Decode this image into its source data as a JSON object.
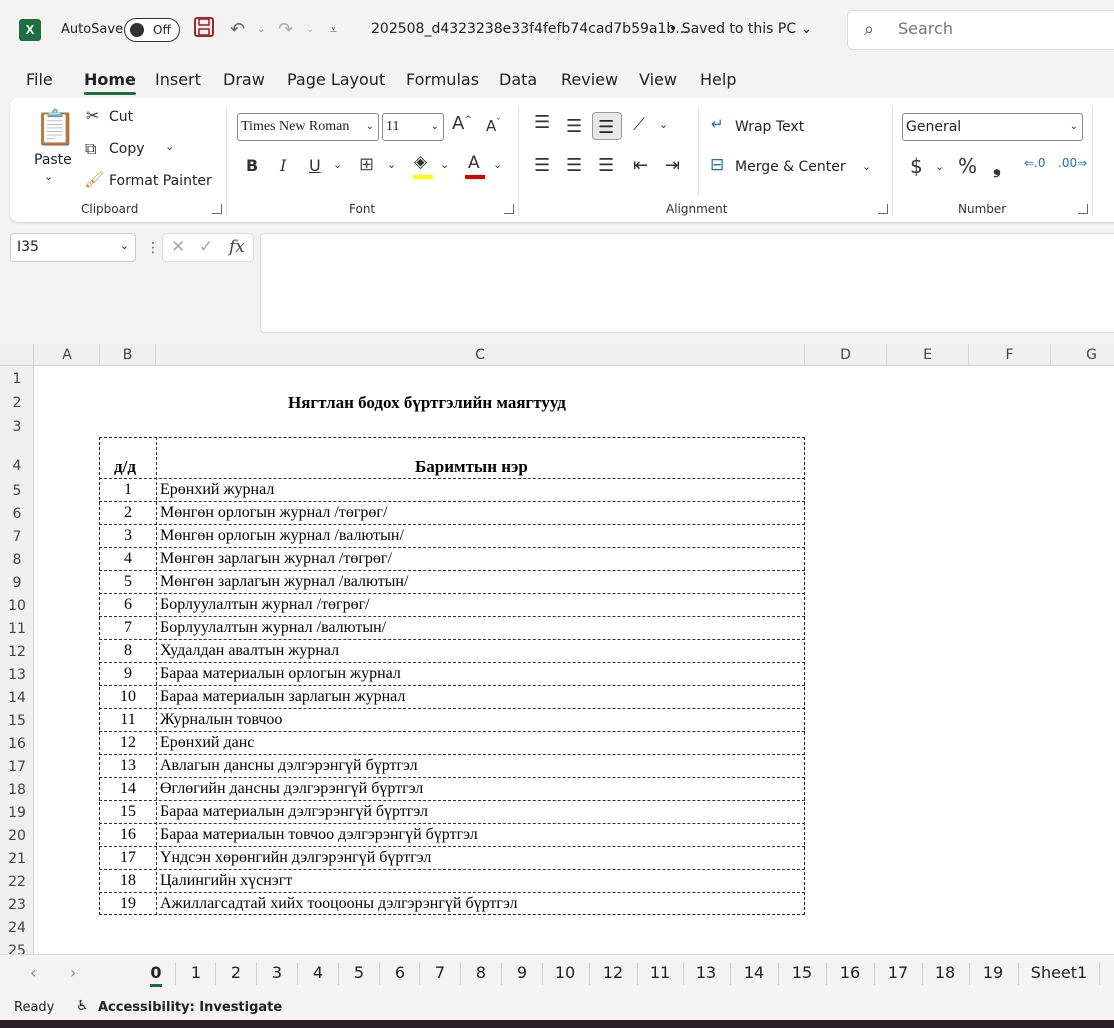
{
  "titlebar": {
    "app_icon": "excel-logo",
    "logo_letter": "X",
    "autosave_label": "AutoSave",
    "autosave_state": "Off",
    "filename": "202508_d4323238e33f4fefb74cad7b59a1b...",
    "saved_status": "• Saved to this PC",
    "search_placeholder": "Search"
  },
  "tabs": [
    "File",
    "Home",
    "Insert",
    "Draw",
    "Page Layout",
    "Formulas",
    "Data",
    "Review",
    "View",
    "Help"
  ],
  "active_tab": "Home",
  "ribbon": {
    "clipboard": {
      "label": "Clipboard",
      "paste": "Paste",
      "cut": "Cut",
      "copy": "Copy",
      "format_painter": "Format Painter"
    },
    "font": {
      "label": "Font",
      "font_name": "Times New Roman",
      "font_size": "11",
      "bold": "B",
      "italic": "I",
      "underline": "U"
    },
    "alignment": {
      "label": "Alignment",
      "wrap_text": "Wrap Text",
      "merge_center": "Merge & Center"
    },
    "number": {
      "label": "Number",
      "format": "General",
      "currency": "$",
      "percent": "%",
      "comma": "❟"
    }
  },
  "formula_bar": {
    "name_box": "I35",
    "formula": ""
  },
  "grid": {
    "columns": [
      "A",
      "B",
      "C",
      "D",
      "E",
      "F",
      "G"
    ],
    "rows": [
      "1",
      "2",
      "3",
      "4",
      "5",
      "6",
      "7",
      "8",
      "9",
      "10",
      "11",
      "12",
      "13",
      "14",
      "15",
      "16",
      "17",
      "18",
      "19",
      "20",
      "21",
      "22",
      "23",
      "24",
      "25"
    ],
    "sheet_title": "Нягтлан бодох бүртгэлийн маягтууд",
    "header_num": "д/д",
    "header_name": "Баримтын нэр",
    "items": [
      {
        "n": "1",
        "name": "Ерөнхий журнал"
      },
      {
        "n": "2",
        "name": "Мөнгөн орлогын журнал /төгрөг/"
      },
      {
        "n": "3",
        "name": "Мөнгөн орлогын журнал /валютын/"
      },
      {
        "n": "4",
        "name": "Мөнгөн зарлагын журнал /төгрөг/"
      },
      {
        "n": "5",
        "name": "Мөнгөн зарлагын журнал /валютын/"
      },
      {
        "n": "6",
        "name": "Борлуулалтын журнал /төгрөг/"
      },
      {
        "n": "7",
        "name": "Борлуулалтын журнал /валютын/"
      },
      {
        "n": "8",
        "name": "Худалдан авалтын журнал"
      },
      {
        "n": "9",
        "name": "Бараа материалын орлогын журнал"
      },
      {
        "n": "10",
        "name": "Бараа материалын зарлагын журнал"
      },
      {
        "n": "11",
        "name": "Журналын товчоо"
      },
      {
        "n": "12",
        "name": "Ерөнхий данс"
      },
      {
        "n": "13",
        "name": "Авлагын дансны дэлгэрэнгүй бүртгэл"
      },
      {
        "n": "14",
        "name": "Өглөгийн дансны дэлгэрэнгүй бүртгэл"
      },
      {
        "n": "15",
        "name": "Бараа материалын дэлгэрэнгүй бүртгэл"
      },
      {
        "n": "16",
        "name": "Бараа материалын товчоо дэлгэрэнгүй бүртгэл"
      },
      {
        "n": "17",
        "name": "Үндсэн хөрөнгийн дэлгэрэнгүй бүртгэл"
      },
      {
        "n": "18",
        "name": "Цалингийн хүснэгт"
      },
      {
        "n": "19",
        "name": "Ажиллагсадтай хийх тооцооны дэлгэрэнгүй бүртгэл"
      }
    ]
  },
  "sheet_tabs": [
    "0",
    "1",
    "2",
    "3",
    "4",
    "5",
    "6",
    "7",
    "8",
    "9",
    "10",
    "12",
    "11",
    "13",
    "14",
    "15",
    "16",
    "17",
    "18",
    "19",
    "Sheet1"
  ],
  "active_sheet": "0",
  "status": {
    "ready": "Ready",
    "accessibility": "Accessibility: Investigate"
  },
  "colors": {
    "excel_green": "#1d6f42",
    "save_red": "#a4262c",
    "highlight_yellow": "#ffff00",
    "font_red": "#e00000"
  }
}
